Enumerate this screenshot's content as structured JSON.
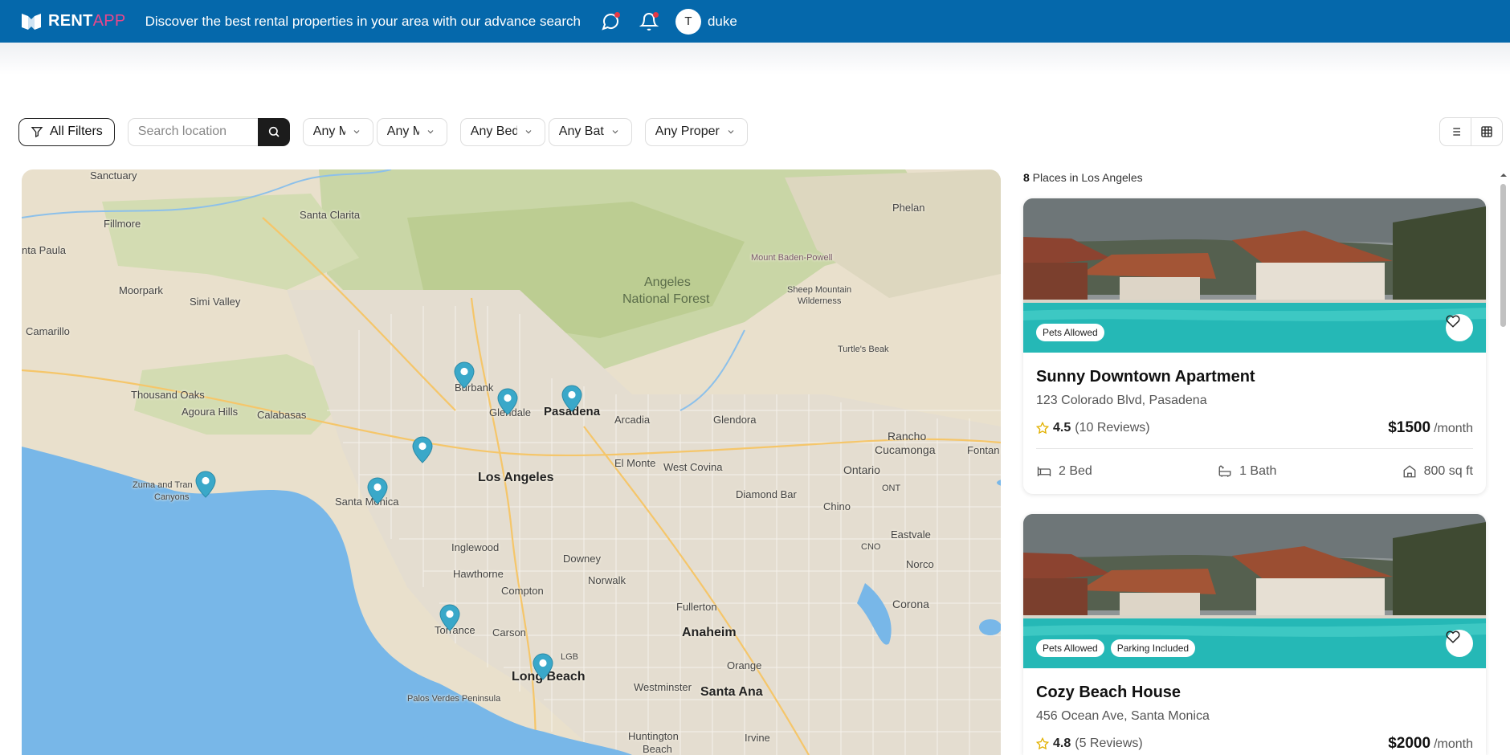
{
  "header": {
    "logo_main": "RENT",
    "logo_accent": "APP",
    "tagline": "Discover the best rental properties in your area with our advance search",
    "avatar_initial": "T",
    "username": "duke",
    "brand_color": "#0568ab",
    "accent_color": "#e8478b"
  },
  "filters": {
    "all_filters_label": "All Filters",
    "search_placeholder": "Search location",
    "dropdowns": [
      "Any M",
      "Any M",
      "Any Bed",
      "Any Bat",
      "Any Proper"
    ]
  },
  "map": {
    "places": [
      "Sanctuary",
      "Fillmore",
      "Santa Clarita",
      "nta Paula",
      "Moorpark",
      "Simi Valley",
      "Camarillo",
      "Thousand Oaks",
      "Agoura Hills",
      "Calabasas",
      "Zuma and Tran",
      "Canyons",
      "Burbank",
      "Glendale",
      "Pasadena",
      "Arcadia",
      "Glendora",
      "Rancho",
      "Cucamonga",
      "Fontan",
      "Los Angeles",
      "El Monte",
      "West Covina",
      "Ontario",
      "Santa Monica",
      "Diamond Bar",
      "Chino",
      "ONT",
      "Inglewood",
      "Eastvale",
      "Hawthorne",
      "CNO",
      "Norco",
      "Downey",
      "Compton",
      "Norwalk",
      "Corona",
      "Fullerton",
      "Torrance",
      "Carson",
      "Anaheim",
      "LGB",
      "Long Beach",
      "Orange",
      "Palos Verdes Peninsula",
      "Westminster",
      "Santa Ana",
      "Huntington",
      "Beach",
      "Irvine",
      "Phelan",
      "Mount Baden-Powell",
      "Sheep Mountain",
      "Wilderness",
      "Turtle's Beak",
      "Angeles",
      "National Forest"
    ],
    "marker_count": 8
  },
  "listings": {
    "count": "8",
    "count_suffix": " Places in Los Angeles",
    "items": [
      {
        "title": "Sunny Downtown Apartment",
        "address": "123 Colorado Blvd, Pasadena",
        "rating": "4.5",
        "reviews": "(10 Reviews)",
        "price": "$1500",
        "price_unit": "/month",
        "badges": [
          "Pets Allowed"
        ],
        "beds": "2 Bed",
        "baths": "1 Bath",
        "area": "800 sq ft"
      },
      {
        "title": "Cozy Beach House",
        "address": "456 Ocean Ave, Santa Monica",
        "rating": "4.8",
        "reviews": "(5 Reviews)",
        "price": "$2000",
        "price_unit": "/month",
        "badges": [
          "Pets Allowed",
          "Parking Included"
        ]
      }
    ]
  }
}
